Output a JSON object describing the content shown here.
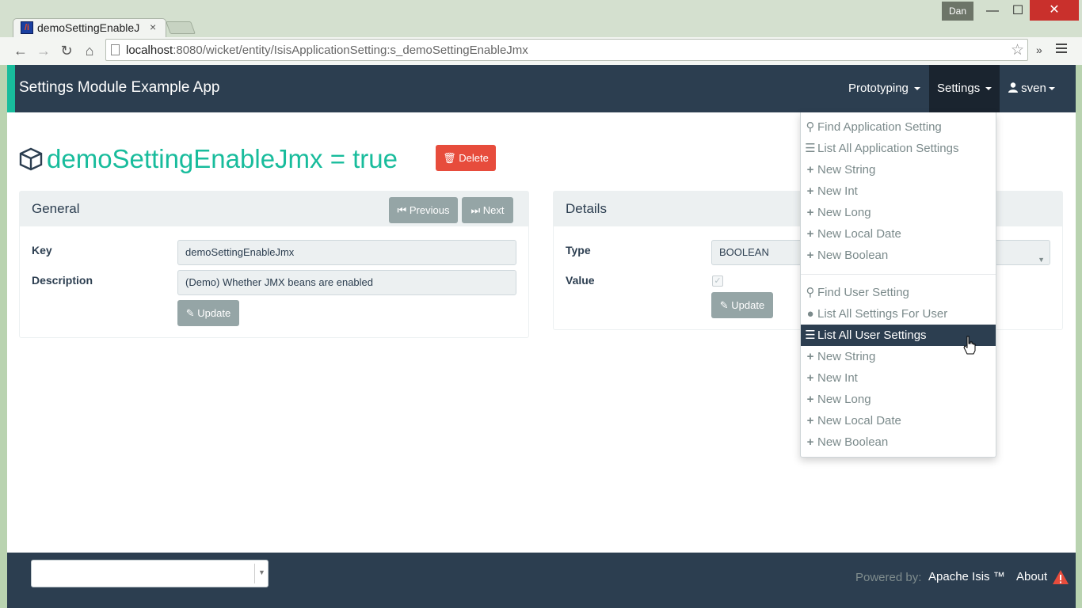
{
  "browser": {
    "tab_title": "demoSettingEnableJ",
    "tab_close": "×",
    "favicon": "/i",
    "user": "Dan",
    "url_host": "localhost",
    "url_rest": ":8080/wicket/entity/IsisApplicationSetting:s_demoSettingEnableJmx",
    "back": "←",
    "forward": "→",
    "reload": "↻",
    "home": "⌂",
    "star": "☆",
    "overflow": "»",
    "minimize": "—",
    "maximize": "☐",
    "close": "✕"
  },
  "navbar": {
    "brand": "Settings Module Example App",
    "prototyping": "Prototyping",
    "settings": "Settings",
    "user": "sven"
  },
  "entity": {
    "title": "demoSettingEnableJmx = true",
    "delete_label": "Delete"
  },
  "general": {
    "title": "General",
    "previous": "Previous",
    "next": "Next",
    "key_label": "Key",
    "key_value": "demoSettingEnableJmx",
    "description_label": "Description",
    "description_value": "(Demo) Whether JMX beans are enabled",
    "update": "Update"
  },
  "details": {
    "title": "Details",
    "type_label": "Type",
    "type_value": "BOOLEAN",
    "value_label": "Value",
    "value_checked": true,
    "update": "Update"
  },
  "settings_menu": {
    "application_items": [
      {
        "icon": "search-icon",
        "label": "Find Application Setting"
      },
      {
        "icon": "list-icon",
        "label": "List All Application Settings"
      },
      {
        "icon": "plus-icon",
        "label": "New String"
      },
      {
        "icon": "plus-icon",
        "label": "New Int"
      },
      {
        "icon": "plus-icon",
        "label": "New Long"
      },
      {
        "icon": "plus-icon",
        "label": "New Local Date"
      },
      {
        "icon": "plus-icon",
        "label": "New Boolean"
      }
    ],
    "user_items": [
      {
        "icon": "search-icon",
        "label": "Find User Setting"
      },
      {
        "icon": "user-icon",
        "label": "List All Settings For User"
      },
      {
        "icon": "list-icon",
        "label": "List All User Settings",
        "active": true
      },
      {
        "icon": "plus-icon",
        "label": "New String"
      },
      {
        "icon": "plus-icon",
        "label": "New Int"
      },
      {
        "icon": "plus-icon",
        "label": "New Long"
      },
      {
        "icon": "plus-icon",
        "label": "New Local Date"
      },
      {
        "icon": "plus-icon",
        "label": "New Boolean"
      }
    ]
  },
  "footer": {
    "powered_by": "Powered by:",
    "apache_isis": "Apache Isis ™",
    "about": "About"
  },
  "colors": {
    "navbar": "#2c3e50",
    "accent": "#18bc9c",
    "danger": "#e74c3c",
    "button_gray": "#95a5a6"
  }
}
